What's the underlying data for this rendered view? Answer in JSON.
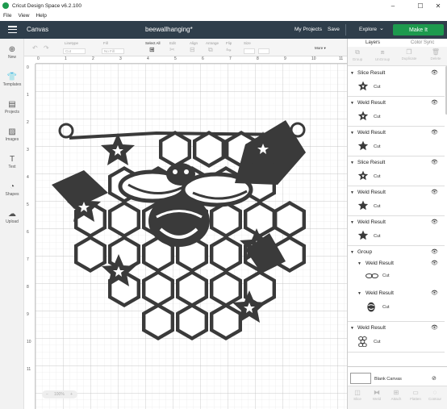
{
  "window": {
    "title": "Cricut Design Space  v6.2.100",
    "minimize": "–",
    "maximize": "☐",
    "close": "✕"
  },
  "menu": [
    "File",
    "View",
    "Help"
  ],
  "header": {
    "canvas_label": "Canvas",
    "project_title": "beewallhanging*",
    "my_projects": "My Projects",
    "save": "Save",
    "machine": "Explore",
    "make_it": "Make It",
    "accent": "#1d9a4e",
    "bar_color": "#2f3e4b"
  },
  "toolbar": {
    "linetype_label": "Linetype",
    "linetype_value": "Cut",
    "fill_label": "Fill",
    "fill_value": "No Fill",
    "select_all_label": "Select All",
    "edit_label": "Edit",
    "align_label": "Align",
    "arrange_label": "Arrange",
    "flip_label": "Flip",
    "size_label": "Size",
    "more_label": "More ▾"
  },
  "left_nav": [
    {
      "label": "New",
      "icon": "plus-icon"
    },
    {
      "label": "Templates",
      "icon": "shirt-icon"
    },
    {
      "label": "Projects",
      "icon": "projects-icon"
    },
    {
      "label": "Images",
      "icon": "image-icon"
    },
    {
      "label": "Text",
      "icon": "text-icon"
    },
    {
      "label": "Shapes",
      "icon": "shapes-icon"
    },
    {
      "label": "Upload",
      "icon": "upload-icon"
    }
  ],
  "ruler": {
    "top": [
      "0",
      "1",
      "2",
      "3",
      "4",
      "5",
      "6",
      "7",
      "8",
      "9",
      "10",
      "11"
    ],
    "left": [
      "0",
      "1",
      "2",
      "3",
      "4",
      "5",
      "6",
      "7",
      "8",
      "9",
      "10",
      "11"
    ]
  },
  "panel": {
    "tabs": [
      "Layers",
      "Color Sync"
    ],
    "layer_tools": [
      "Group",
      "UnGroup",
      "Duplicate",
      "Delete"
    ],
    "layers": [
      {
        "name": "Slice Result",
        "op": "Cut",
        "thumb": "flower"
      },
      {
        "name": "Weld Result",
        "op": "Cut",
        "thumb": "flower"
      },
      {
        "name": "Weld Result",
        "op": "Cut",
        "thumb": "flower"
      },
      {
        "name": "Slice Result",
        "op": "Cut",
        "thumb": "flower"
      },
      {
        "name": "Weld Result",
        "op": "Cut",
        "thumb": "flower"
      },
      {
        "name": "Weld Result",
        "op": "Cut",
        "thumb": "flower"
      }
    ],
    "group": {
      "name": "Group",
      "children": [
        {
          "name": "Weld Result",
          "op": "Cut",
          "thumb": "wings"
        },
        {
          "name": "Weld Result",
          "op": "Cut",
          "thumb": "bee"
        }
      ]
    },
    "last_layer": {
      "name": "Weld Result",
      "op": "Cut",
      "thumb": "honeycomb"
    },
    "blank_canvas": "Blank Canvas",
    "bottom_tools": [
      "Slice",
      "Weld",
      "Attach",
      "Flatten",
      "Contour"
    ]
  },
  "zoom": {
    "value": "100%",
    "minus": "−",
    "plus": "+"
  }
}
